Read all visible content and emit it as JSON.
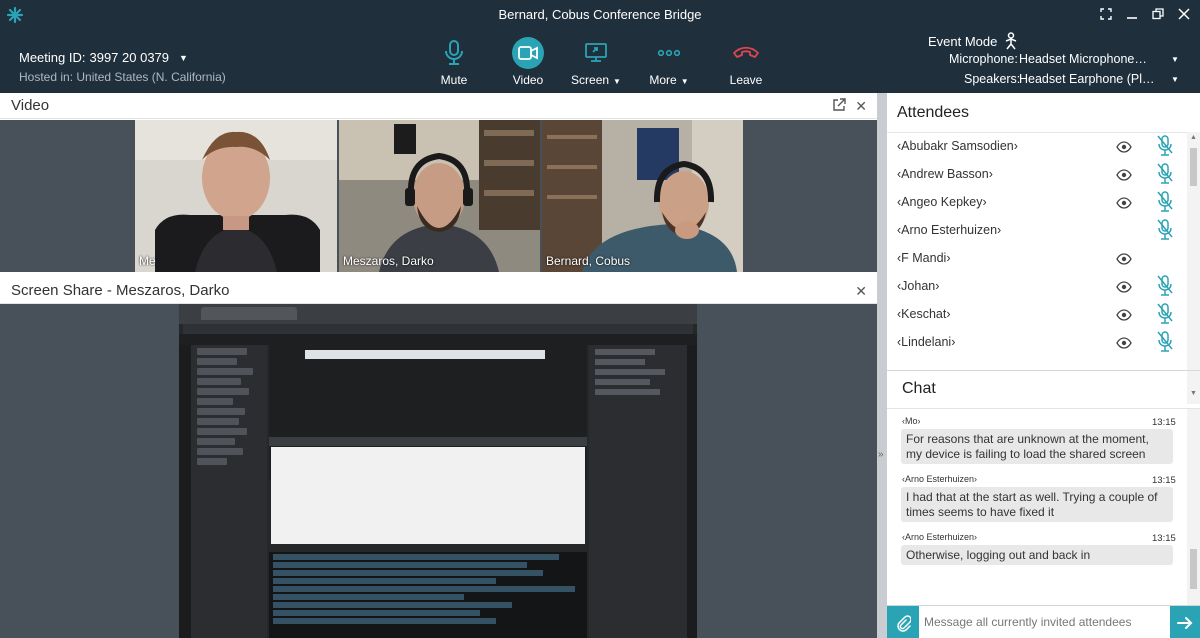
{
  "window": {
    "title": "Bernard, Cobus Conference Bridge",
    "logo_icon": "asterisk-logo-icon",
    "controls": [
      "fullscreen-icon",
      "close-icon",
      "restore-icon",
      "close-window-icon"
    ]
  },
  "meeting": {
    "id_label": "Meeting ID:",
    "id_value": "3997 20 0379",
    "hosted": "Hosted in: United States (N. California)"
  },
  "toolbar": {
    "mute": "Mute",
    "video": "Video",
    "screen": "Screen",
    "more": "More",
    "leave": "Leave"
  },
  "devices": {
    "event_mode": "Event Mode",
    "microphone_label": "Microphone:",
    "microphone_value": "Headset Microphone…",
    "speakers_label": "Speakers:",
    "speakers_value": "Headset Earphone (Pl…"
  },
  "video_panel": {
    "title": "Video",
    "tiles": [
      {
        "name": "Me"
      },
      {
        "name": "Meszaros, Darko"
      },
      {
        "name": "Bernard, Cobus"
      }
    ]
  },
  "share_panel": {
    "title": "Screen Share - Meszaros, Darko"
  },
  "attendees": {
    "title": "Attendees",
    "items": [
      {
        "name": "‹Abubakr Samsodien›",
        "eye": true,
        "mic": true
      },
      {
        "name": "‹Andrew Basson›",
        "eye": true,
        "mic": true
      },
      {
        "name": "‹Angeo Kepkey›",
        "eye": true,
        "mic": true
      },
      {
        "name": "‹Arno Esterhuizen›",
        "eye": false,
        "mic": true
      },
      {
        "name": "‹F Mandi›",
        "eye": true,
        "mic": false
      },
      {
        "name": "‹Johan›",
        "eye": true,
        "mic": true
      },
      {
        "name": "‹Keschat›",
        "eye": true,
        "mic": true
      },
      {
        "name": "‹Lindelani›",
        "eye": true,
        "mic": true
      }
    ]
  },
  "chat": {
    "title": "Chat",
    "messages": [
      {
        "sender": "‹Mo›",
        "time": "13:15",
        "text": "For reasons that are unknown at the moment, my device is failing to load the shared screen"
      },
      {
        "sender": "‹Arno Esterhuizen›",
        "time": "13:15",
        "text": "I had that at the start as well. Trying a couple of times seems to have fixed it"
      },
      {
        "sender": "‹Arno Esterhuizen›",
        "time": "13:15",
        "text": "Otherwise, logging out and back in"
      }
    ],
    "placeholder": "Message all currently invited attendees"
  },
  "colors": {
    "topbar": "#1f2f3c",
    "accent": "#2aa3b4",
    "leave": "#e0454f"
  }
}
